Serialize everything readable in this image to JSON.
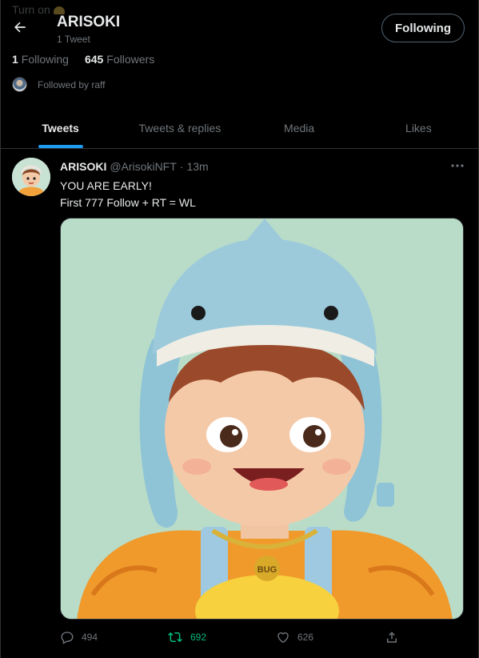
{
  "background_notice": {
    "text": "Turn on"
  },
  "header": {
    "back_icon": "arrow-left-icon",
    "title": "ARISOKI",
    "subtitle": "1 Tweet",
    "follow_button": "Following"
  },
  "stats": {
    "following_count": "1",
    "following_label": "Following",
    "followers_count": "645",
    "followers_label": "Followers"
  },
  "followed_by": {
    "text": "Followed by raff"
  },
  "tabs": [
    {
      "label": "Tweets",
      "active": true
    },
    {
      "label": "Tweets & replies",
      "active": false
    },
    {
      "label": "Media",
      "active": false
    },
    {
      "label": "Likes",
      "active": false
    }
  ],
  "tweet": {
    "name": "ARISOKI",
    "handle": "@ArisokiNFT",
    "separator": "·",
    "time": "13m",
    "lines": [
      "YOU ARE EARLY!",
      "First 777 Follow + RT = WL"
    ],
    "media_badge": "BUG",
    "actions": {
      "replies": "494",
      "retweets": "692",
      "likes": "626"
    }
  },
  "colors": {
    "accent": "#1d9bf0",
    "retweet_active": "#00ba7c",
    "muted": "#71767b",
    "background": "#000000"
  }
}
